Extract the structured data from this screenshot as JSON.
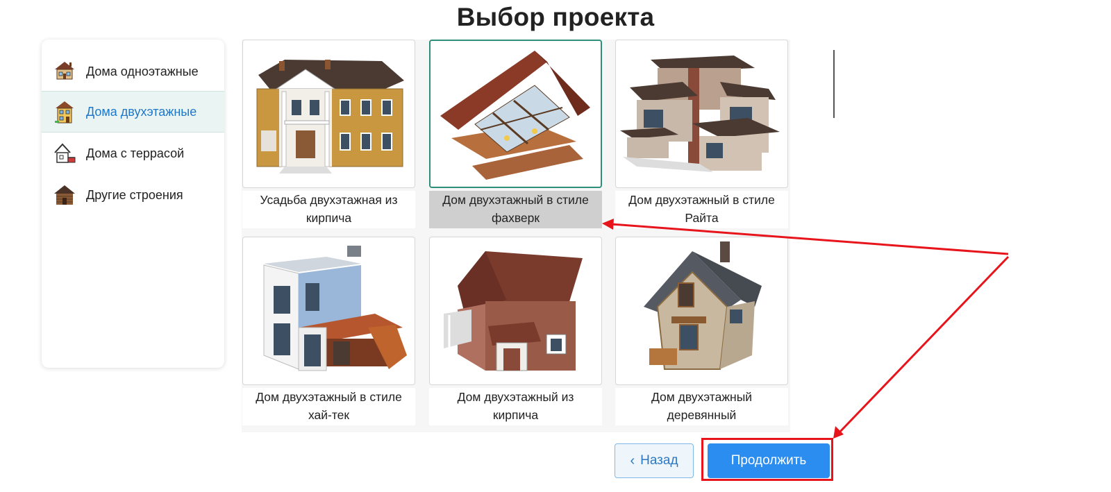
{
  "page": {
    "title": "Выбор проекта"
  },
  "sidebar": {
    "items": [
      {
        "label": "Дома одноэтажные",
        "icon": "one-story-house-icon",
        "active": false
      },
      {
        "label": "Дома двухэтажные",
        "icon": "two-story-house-icon",
        "active": true
      },
      {
        "label": "Дома с террасой",
        "icon": "terrace-house-icon",
        "active": false
      },
      {
        "label": "Другие строения",
        "icon": "log-cabin-icon",
        "active": false
      }
    ]
  },
  "projects": [
    {
      "caption_line1": "Усадьба двухэтажная из",
      "caption_line2": "кирпича",
      "selected": false,
      "image": "manor-house-image"
    },
    {
      "caption_line1": "Дом двухэтажный в стиле",
      "caption_line2": "фахверк",
      "selected": true,
      "image": "fachwerk-house-image"
    },
    {
      "caption_line1": "Дом двухэтажный в стиле",
      "caption_line2": "Райта",
      "selected": false,
      "image": "wright-style-house-image"
    },
    {
      "caption_line1": "Дом двухэтажный в стиле",
      "caption_line2": "хай-тек",
      "selected": false,
      "image": "hi-tech-house-image"
    },
    {
      "caption_line1": "Дом двухэтажный из",
      "caption_line2": "кирпича",
      "selected": false,
      "image": "brick-house-image"
    },
    {
      "caption_line1": "Дом двухэтажный",
      "caption_line2": "деревянный",
      "selected": false,
      "image": "wooden-house-image"
    }
  ],
  "footer": {
    "back_label": "Назад",
    "back_icon": "chevron-left-icon",
    "next_label": "Продолжить"
  },
  "colors": {
    "accent": "#2b8df0",
    "selected_border": "#2d8f79",
    "annotation": "#e8141b",
    "active_text": "#1f77c9"
  }
}
